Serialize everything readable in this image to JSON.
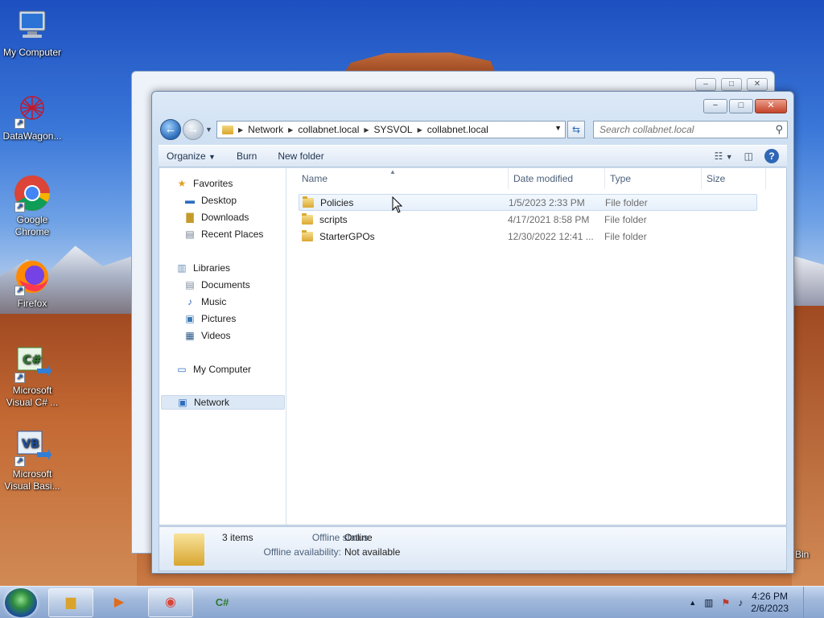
{
  "desktop": {
    "icons": [
      {
        "label": "My Computer",
        "icon": "my-computer-icon"
      },
      {
        "label": "DataWagon...",
        "icon": "datawagon-icon"
      },
      {
        "label": "Google Chrome",
        "icon": "chrome-icon"
      },
      {
        "label": "Firefox",
        "icon": "firefox-icon"
      },
      {
        "label": "Microsoft Visual C# ...",
        "icon": "visual-csharp-icon"
      },
      {
        "label": "Microsoft Visual Basi...",
        "icon": "visual-basic-icon"
      },
      {
        "label": "Bin",
        "icon": "recycle-bin-icon"
      }
    ]
  },
  "explorer": {
    "caption": {
      "minimize": "−",
      "maximize": "□",
      "close": "✕"
    },
    "breadcrumb": [
      "Network",
      "collabnet.local",
      "SYSVOL",
      "collabnet.local"
    ],
    "search_placeholder": "Search collabnet.local",
    "toolbar": {
      "organize": "Organize",
      "burn": "Burn",
      "new_folder": "New folder"
    },
    "nav": {
      "favorites": "Favorites",
      "favorites_items": [
        "Desktop",
        "Downloads",
        "Recent Places"
      ],
      "libraries": "Libraries",
      "libraries_items": [
        "Documents",
        "Music",
        "Pictures",
        "Videos"
      ],
      "my_computer": "My Computer",
      "network": "Network"
    },
    "columns": {
      "name": "Name",
      "date": "Date modified",
      "type": "Type",
      "size": "Size"
    },
    "files": [
      {
        "name": "Policies",
        "date": "1/5/2023 2:33 PM",
        "type": "File folder"
      },
      {
        "name": "scripts",
        "date": "4/17/2021 8:58 PM",
        "type": "File folder"
      },
      {
        "name": "StarterGPOs",
        "date": "12/30/2022 12:41 ...",
        "type": "File folder"
      }
    ],
    "details": {
      "count": "3 items",
      "offline_status_label": "Offline status:",
      "offline_status": "Online",
      "offline_availability_label": "Offline availability:",
      "offline_availability": "Not available"
    }
  },
  "taskbar": {
    "clock_time": "4:26 PM",
    "clock_date": "2/6/2023"
  }
}
